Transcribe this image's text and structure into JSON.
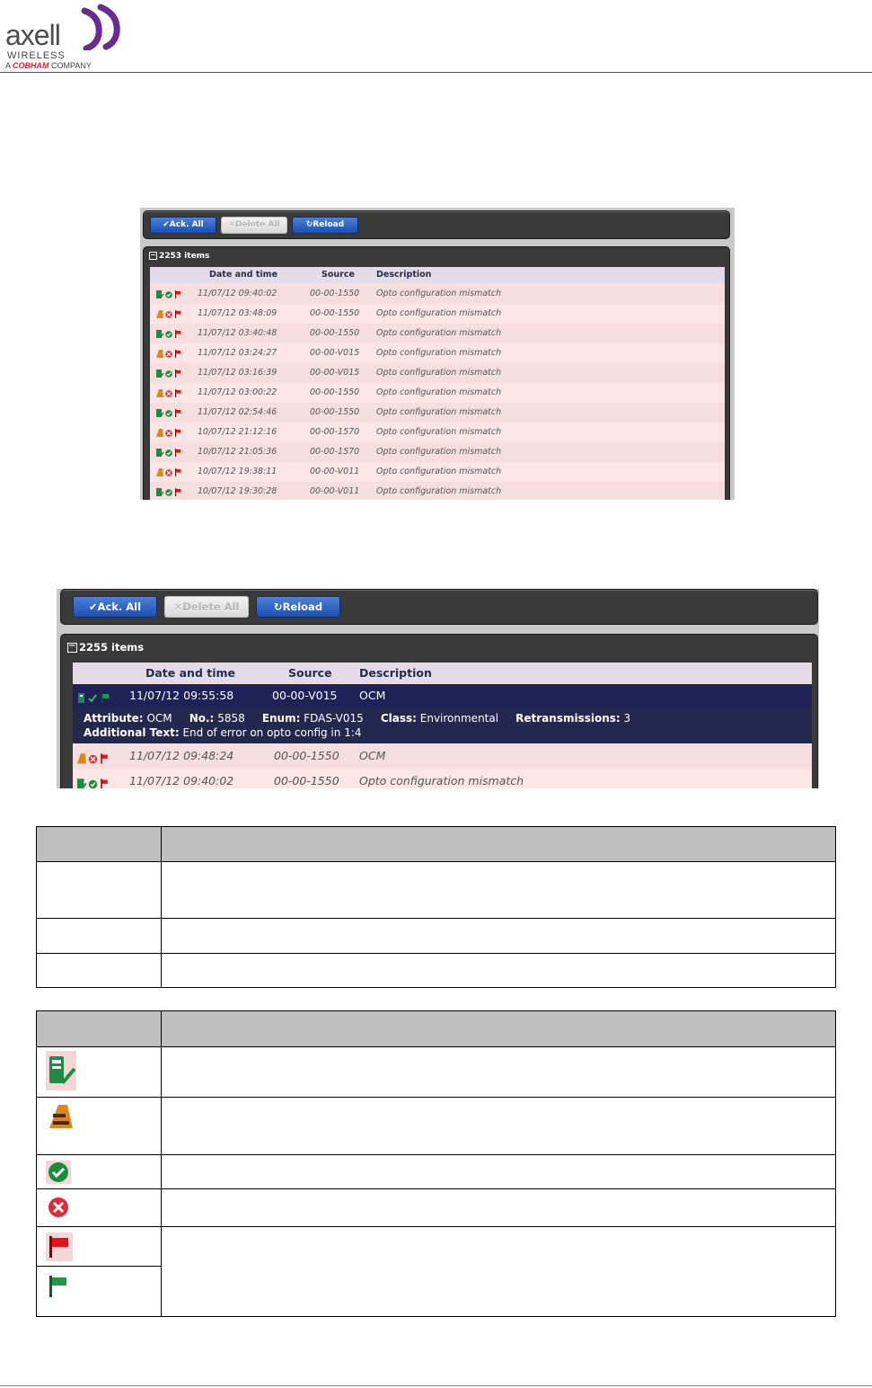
{
  "header": {
    "brand": "axell",
    "sub": "WIRELESS",
    "company_prefix": "A",
    "company_brand": "COBHAM",
    "company_suffix": "COMPANY"
  },
  "shot1": {
    "buttons": {
      "ack": "Ack. All",
      "delete": "Delete All",
      "reload": "Reload"
    },
    "count": "2253 items",
    "columns": [
      "Date and time",
      "Source",
      "Description"
    ],
    "rows": [
      {
        "status": "acked",
        "date": "11/07/12 09:40:02",
        "source": "00-00-1550",
        "desc": "Opto configuration mismatch"
      },
      {
        "status": "unacked",
        "date": "11/07/12 03:48:09",
        "source": "00-00-1550",
        "desc": "Opto configuration mismatch"
      },
      {
        "status": "acked",
        "date": "11/07/12 03:40:48",
        "source": "00-00-1550",
        "desc": "Opto configuration mismatch"
      },
      {
        "status": "unacked",
        "date": "11/07/12 03:24:27",
        "source": "00-00-V015",
        "desc": "Opto configuration mismatch"
      },
      {
        "status": "acked",
        "date": "11/07/12 03:16:39",
        "source": "00-00-V015",
        "desc": "Opto configuration mismatch"
      },
      {
        "status": "unacked",
        "date": "11/07/12 03:00:22",
        "source": "00-00-1550",
        "desc": "Opto configuration mismatch"
      },
      {
        "status": "acked",
        "date": "11/07/12 02:54:46",
        "source": "00-00-1550",
        "desc": "Opto configuration mismatch"
      },
      {
        "status": "unacked",
        "date": "10/07/12 21:12:16",
        "source": "00-00-1570",
        "desc": "Opto configuration mismatch"
      },
      {
        "status": "acked",
        "date": "10/07/12 21:05:36",
        "source": "00-00-1570",
        "desc": "Opto configuration mismatch"
      },
      {
        "status": "unacked",
        "date": "10/07/12 19:38:11",
        "source": "00-00-V011",
        "desc": "Opto configuration mismatch"
      },
      {
        "status": "acked",
        "date": "10/07/12 19:30:28",
        "source": "00-00-V011",
        "desc": "Opto configuration mismatch"
      }
    ]
  },
  "shot2": {
    "buttons": {
      "ack": "Ack. All",
      "delete": "Delete All",
      "reload": "Reload"
    },
    "count": "2255 items",
    "columns": [
      "Date and time",
      "Source",
      "Description"
    ],
    "selected": {
      "date": "11/07/12 09:55:58",
      "source": "00-00-V015",
      "desc": "OCM"
    },
    "detail": {
      "attribute_label": "Attribute:",
      "attribute": "OCM",
      "no_label": "No.:",
      "no": "5858",
      "enum_label": "Enum:",
      "enum": "FDAS-V015",
      "class_label": "Class:",
      "class": "Environmental",
      "retrans_label": "Retransmissions:",
      "retrans": "3",
      "addtext_label": "Additional Text:",
      "addtext": "End of error on opto config in 1:4"
    },
    "rows": [
      {
        "status": "unacked",
        "date": "11/07/12 09:48:24",
        "source": "00-00-1550",
        "desc": "OCM"
      },
      {
        "status": "acked",
        "date": "11/07/12 09:40:02",
        "source": "00-00-1550",
        "desc": "Opto configuration mismatch"
      }
    ]
  },
  "colors": {
    "flag_red": "#e8101a",
    "flag_green": "#1d9a48",
    "check_green": "#1a8c3a",
    "x_red": "#e02a3a",
    "select_navy": "#1e2256"
  }
}
